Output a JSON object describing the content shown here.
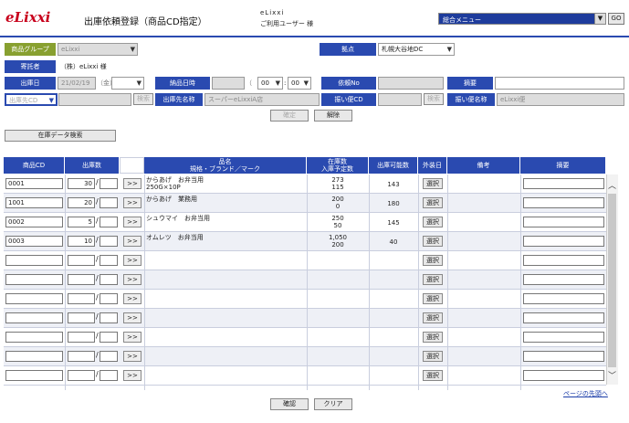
{
  "header": {
    "logo": "eLixxi",
    "page_title": "出庫依頼登録（商品CD指定）",
    "company": "eLixxi",
    "user": "ご利用ユーザー 様",
    "menu": "総合メニュー",
    "go_label": "GO"
  },
  "form": {
    "product_group_label": "商品グループ",
    "product_group_value": "eLixxi",
    "base_label": "拠点",
    "base_value": "札幌大谷地DC",
    "consignor_label": "寄託者",
    "consignor_value": "（株）eLixxi 様",
    "ship_date_label": "出庫日",
    "ship_date_value": "21/02/19",
    "ship_date_suffix": "（金）",
    "delivery_label": "納品日時",
    "delivery_day_suffix": "（",
    "hour_value": "00",
    "minute_value": "00",
    "request_no_label": "依頼No",
    "summary_label": "摘要",
    "ship_to_code_label": "出庫先CD",
    "search_label": "検索",
    "ship_to_name_label": "出庫先名称",
    "ship_to_name_value": "スーパーeLixxiA店",
    "remit_cd_label": "振い便CD",
    "remit_name_label": "振い便名称",
    "remit_name_value": "eLixxi便",
    "confirm_label": "確定",
    "cancel_label": "解除",
    "stock_search_label": "在庫データ検索"
  },
  "grid": {
    "col_code": "商品CD",
    "col_qty": "出庫数",
    "col_name_1": "品名",
    "col_name_2": "規格・ブランド／マーク",
    "col_stock_1": "在庫数",
    "col_stock_2": "入庫予定数",
    "col_available": "出庫可能数",
    "col_pack": "外装日",
    "col_note": "備考",
    "col_summary": "摘要",
    "arrow_label": ">>",
    "select_label": "選択",
    "rows": [
      {
        "code": "0001",
        "qty": "30",
        "name": "からあげ　お弁当用",
        "spec": "250G×10P",
        "stock": "273",
        "incoming": "115",
        "available": "143"
      },
      {
        "code": "1001",
        "qty": "20",
        "name": "からあげ　業務用",
        "spec": "",
        "stock": "200",
        "incoming": "0",
        "available": "180"
      },
      {
        "code": "0002",
        "qty": "5",
        "name": "シュウマイ　お弁当用",
        "spec": "",
        "stock": "250",
        "incoming": "50",
        "available": "145"
      },
      {
        "code": "0003",
        "qty": "10",
        "name": "オムレツ　お弁当用",
        "spec": "",
        "stock": "1,050",
        "incoming": "200",
        "available": "40"
      },
      {
        "code": "",
        "qty": "",
        "name": "",
        "spec": "",
        "stock": "",
        "incoming": "",
        "available": ""
      },
      {
        "code": "",
        "qty": "",
        "name": "",
        "spec": "",
        "stock": "",
        "incoming": "",
        "available": ""
      },
      {
        "code": "",
        "qty": "",
        "name": "",
        "spec": "",
        "stock": "",
        "incoming": "",
        "available": ""
      },
      {
        "code": "",
        "qty": "",
        "name": "",
        "spec": "",
        "stock": "",
        "incoming": "",
        "available": ""
      },
      {
        "code": "",
        "qty": "",
        "name": "",
        "spec": "",
        "stock": "",
        "incoming": "",
        "available": ""
      },
      {
        "code": "",
        "qty": "",
        "name": "",
        "spec": "",
        "stock": "",
        "incoming": "",
        "available": ""
      },
      {
        "code": "",
        "qty": "",
        "name": "",
        "spec": "",
        "stock": "",
        "incoming": "",
        "available": ""
      }
    ]
  },
  "footer": {
    "page_top_link": "ページの先頭へ",
    "confirm_label": "確認",
    "clear_label": "クリア"
  },
  "colors": {
    "accent": "#2a4ab0",
    "logo": "#c8001c",
    "group_label": "#88a030"
  }
}
